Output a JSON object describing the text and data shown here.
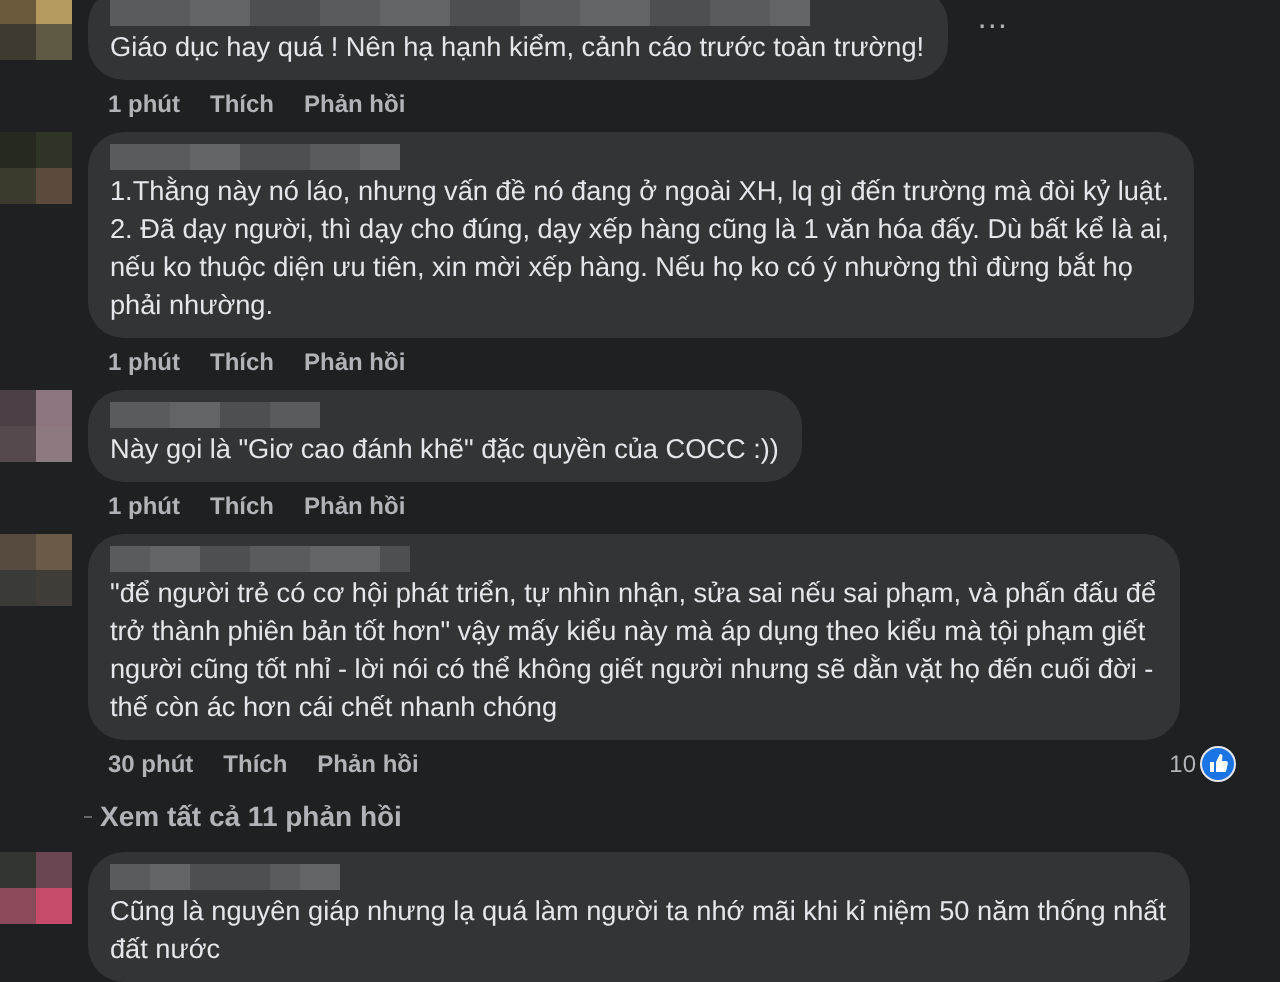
{
  "comments": [
    {
      "lines": [
        "Giáo dục hay quá ! Nên hạ hạnh kiểm, cảnh cáo trước toàn trường!"
      ],
      "time": "1 phút",
      "like": "Thích",
      "reply": "Phản hồi",
      "more": "…"
    },
    {
      "lines": [
        "1.Thằng này nó láo, nhưng vấn đề nó đang ở ngoài XH, lq gì đến trường mà đòi kỷ luật.",
        "2. Đã dạy người, thì dạy cho đúng, dạy xếp hàng cũng là 1 văn hóa đấy. Dù bất kể là ai,",
        "nếu ko thuộc diện ưu tiên, xin mời xếp hàng. Nếu họ ko có ý nhường thì đừng bắt họ",
        "phải nhường."
      ],
      "time": "1 phút",
      "like": "Thích",
      "reply": "Phản hồi"
    },
    {
      "lines": [
        "Này gọi là \"Giơ cao đánh khẽ\" đặc quyền của COCC :))"
      ],
      "time": "1 phút",
      "like": "Thích",
      "reply": "Phản hồi"
    },
    {
      "lines": [
        "\"để người trẻ có cơ hội phát triển, tự nhìn nhận, sửa sai nếu sai phạm, và phấn đấu để",
        "trở thành phiên bản tốt hơn\" vậy mấy kiểu này mà áp dụng theo kiểu mà tội phạm giết",
        "người cũng tốt nhỉ - lời nói có thể không giết người nhưng sẽ dằn vặt họ đến cuối đời -",
        "thế còn ác hơn cái chết nhanh chóng"
      ],
      "time": "30 phút",
      "like": "Thích",
      "reply": "Phản hồi",
      "likes_count": "10"
    },
    {
      "kind": "view_replies",
      "label": "Xem tất cả 11 phản hồi"
    },
    {
      "lines": [
        "Cũng là nguyên giáp nhưng lạ quá làm người ta nhớ mãi khi kỉ niệm 50 năm thống nhất",
        "đất nước"
      ]
    }
  ]
}
